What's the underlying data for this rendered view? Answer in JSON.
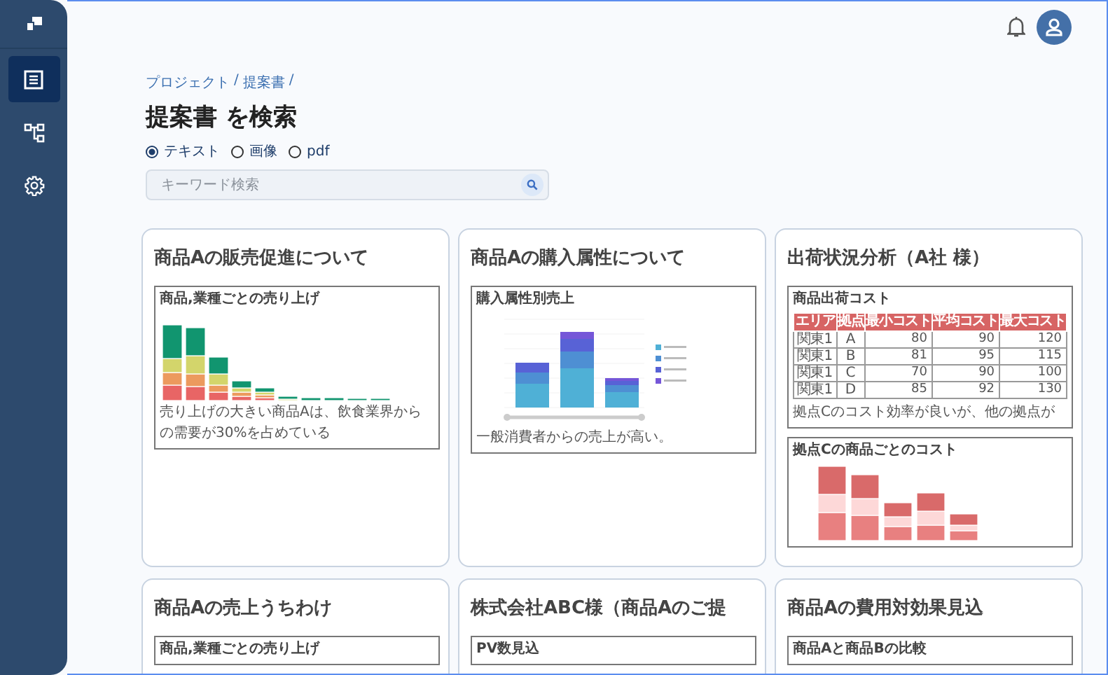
{
  "sidebar": {
    "items": [
      {
        "kind": "list",
        "selected": true
      },
      {
        "kind": "hierarchy",
        "selected": false
      },
      {
        "kind": "settings",
        "selected": false
      }
    ]
  },
  "breadcrumb": {
    "items": [
      "プロジェクト",
      "提案書"
    ],
    "separator": "/"
  },
  "title": "提案書 を検索",
  "search_types": [
    {
      "label": "テキスト",
      "selected": true
    },
    {
      "label": "画像",
      "selected": false
    },
    {
      "label": "pdf",
      "selected": false
    }
  ],
  "search": {
    "placeholder": "キーワード検索"
  },
  "cards": [
    {
      "title": "商品Aの販売促進について",
      "previews": [
        {
          "kind": "sales-bars",
          "caption": "商品,業種ごとの売り上げ",
          "note": "売り上げの大きい商品Aは、飲食業界からの需要が30%を占めている"
        }
      ]
    },
    {
      "title": "商品Aの購入属性について",
      "previews": [
        {
          "kind": "attribute-bars",
          "caption": "購入属性別売上",
          "note": "一般消費者からの売上が高い。"
        }
      ]
    },
    {
      "title": "出荷状況分析（A社 様）",
      "previews": [
        {
          "kind": "table",
          "caption": "商品出荷コスト",
          "columns": [
            "エリア",
            "拠点",
            "最小コスト",
            "平均コスト",
            "最大コスト"
          ],
          "rows": [
            [
              "関東1",
              "A",
              "80",
              "90",
              "120"
            ],
            [
              "関東1",
              "B",
              "81",
              "95",
              "115"
            ],
            [
              "関東1",
              "C",
              "70",
              "90",
              "100"
            ],
            [
              "関東1",
              "D",
              "85",
              "92",
              "130"
            ]
          ],
          "note": "拠点Cのコスト効率が良いが、他の拠点が"
        },
        {
          "kind": "cost-bars",
          "caption": "拠点Cの商品ごとのコスト"
        }
      ]
    },
    {
      "title": "商品Aの売上うちわけ",
      "previews": [
        {
          "caption": "商品,業種ごとの売り上げ"
        }
      ]
    },
    {
      "title": "株式会社ABC様（商品Aのご提",
      "previews": [
        {
          "caption": "PV数見込"
        }
      ]
    },
    {
      "title": "商品Aの費用対効果見込",
      "previews": [
        {
          "caption": "商品Aと商品Bの比較"
        }
      ]
    }
  ]
}
